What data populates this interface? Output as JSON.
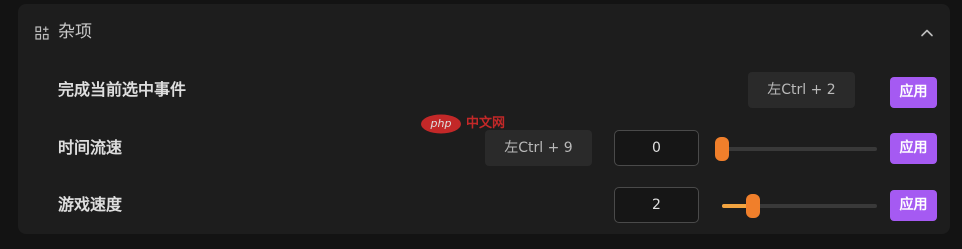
{
  "panel": {
    "title": "杂项",
    "icons": {
      "section": "grid-icon",
      "collapse": "chevron-up-icon"
    }
  },
  "rows": [
    {
      "label": "完成当前选中事件",
      "hotkey": "左Ctrl + 2",
      "apply_label": "应用"
    },
    {
      "label": "时间流速",
      "hotkey": "左Ctrl + 9",
      "input_value": "0",
      "slider_value": 0,
      "apply_label": "应用"
    },
    {
      "label": "游戏速度",
      "input_value": "2",
      "slider_value": 2,
      "apply_label": "应用"
    }
  ],
  "watermark": {
    "logo_text": "php",
    "text": "中文网"
  },
  "colors": {
    "accent_button": "#a55af2",
    "slider_thumb": "#f07f2b",
    "slider_fill": "#f2a440"
  }
}
